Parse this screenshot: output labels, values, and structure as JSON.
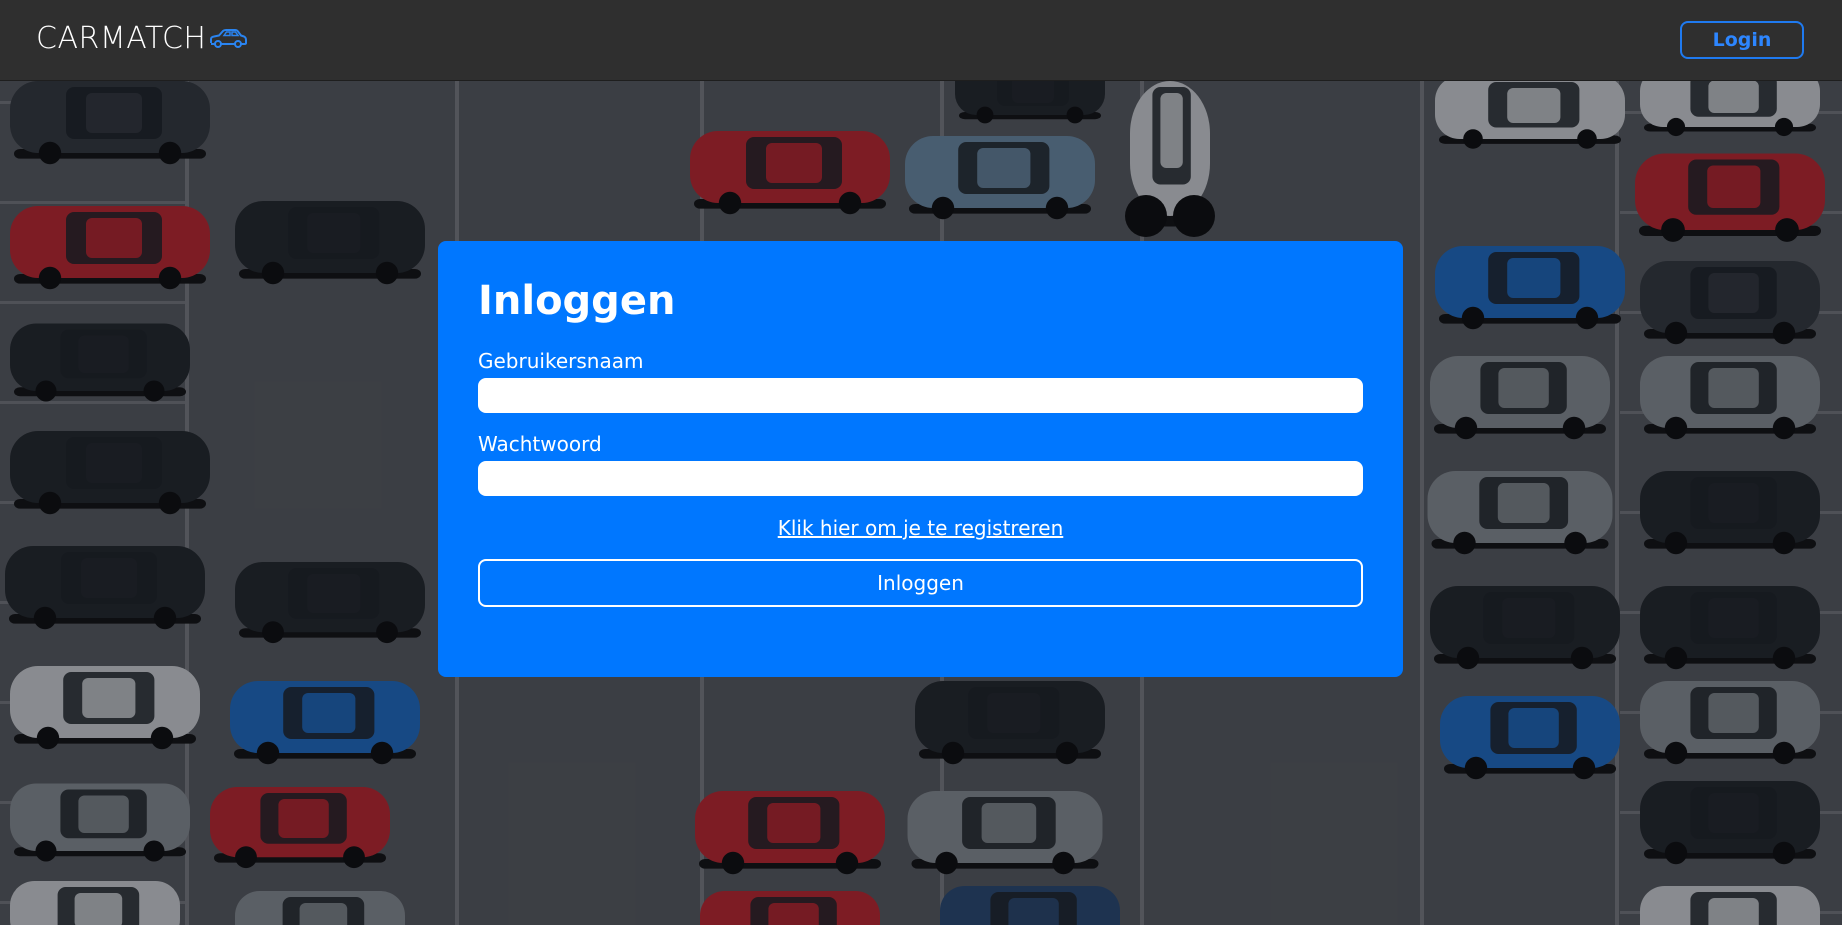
{
  "navbar": {
    "brand": "CARMATCH",
    "brand_icon": "car-icon",
    "login_label": "Login"
  },
  "background": {
    "description_icon": "parking-lot-image"
  },
  "login_form": {
    "title": "Inloggen",
    "username_label": "Gebruikersnaam",
    "username_value": "",
    "password_label": "Wachtwoord",
    "password_value": "",
    "register_link": "Klik hier om je te registreren",
    "submit_label": "Inloggen"
  },
  "colors": {
    "navbar_bg": "#2f2f2f",
    "card_bg": "#0077ff",
    "accent": "#1f7af0"
  }
}
